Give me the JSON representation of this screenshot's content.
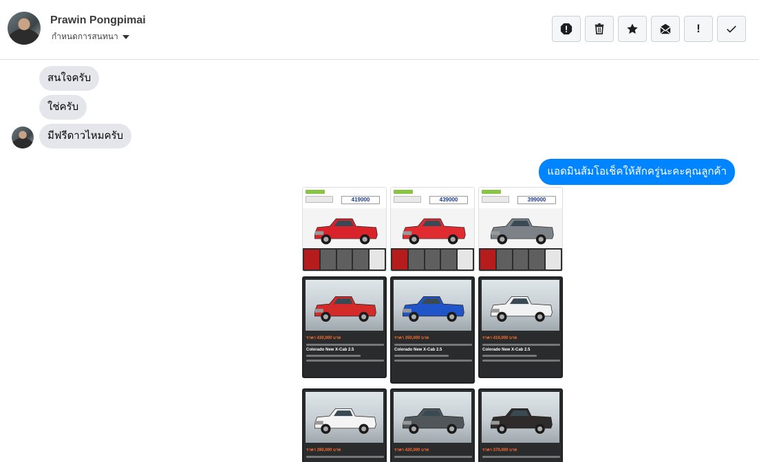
{
  "header": {
    "name": "Prawin Pongpimai",
    "subtitle": "กำหนดการสนทนา"
  },
  "toolbar": [
    "report-icon",
    "trash-icon",
    "star-icon",
    "mark-unread-icon",
    "exclamation-icon",
    "check-icon"
  ],
  "messages": {
    "incoming": [
      "สนใจครับ",
      "ใช่ครับ",
      "มีฟรีดาวไหมครับ"
    ],
    "outgoing": "แอดมินส้มโอเช็คให้สักครู่นะคะคุณลูกค้า"
  },
  "flyers": [
    {
      "price": "419000",
      "car_color": "#d8232a"
    },
    {
      "price": "439000",
      "car_color": "#e02b30"
    },
    {
      "price": "399000",
      "car_color": "#7c8287"
    }
  ],
  "listings": [
    {
      "price": "ราคา 430,000 บาท",
      "model": "Colorado New X-Cab 2.5",
      "car_color": "#d42a2a"
    },
    {
      "price": "ราคา 350,000 บาท",
      "model": "Colorado New X-Cab 2.5",
      "car_color": "#1f55c8"
    },
    {
      "price": "ราคา 410,000 บาท",
      "model": "Colorado New X-Cab 2.5",
      "car_color": "#f2f2f2"
    },
    {
      "price": "ราคา 390,000 บาท",
      "model": "",
      "car_color": "#f4f4f4"
    },
    {
      "price": "ราคา 420,000 บาท",
      "model": "",
      "car_color": "#50565a"
    },
    {
      "price": "ราคา 370,000 บาท",
      "model": "",
      "car_color": "#2f2b2b"
    }
  ]
}
